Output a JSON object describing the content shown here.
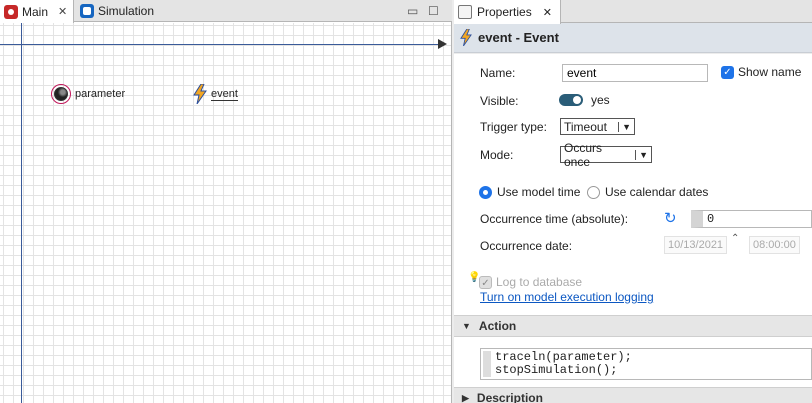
{
  "editor": {
    "tabs": [
      {
        "label": "Main",
        "icon": "main-icon",
        "active": true
      },
      {
        "label": "Simulation",
        "icon": "simulation-icon",
        "active": false
      }
    ],
    "minimize_glyph": "▭",
    "maximize_glyph": "☐",
    "canvas": {
      "elements": [
        {
          "type": "parameter",
          "label": "parameter",
          "icon": "parameter-icon"
        },
        {
          "type": "event",
          "label": "event",
          "icon": "lightning-icon"
        }
      ]
    }
  },
  "properties": {
    "tab_label": "Properties",
    "header": {
      "name": "event",
      "type": "Event",
      "title": "event - Event"
    },
    "name_label": "Name:",
    "name_value": "event",
    "show_name_label": "Show name",
    "show_name_checked": true,
    "visible_label": "Visible:",
    "visible_value": "yes",
    "trigger_label": "Trigger type:",
    "trigger_value": "Timeout",
    "mode_label": "Mode:",
    "mode_value": "Occurs once",
    "use_model_time_label": "Use model time",
    "use_calendar_label": "Use calendar dates",
    "time_mode_selected": "Use model time",
    "occurrence_time_label": "Occurrence time (absolute):",
    "occurrence_time_value": "0",
    "occurrence_date_label": "Occurrence date:",
    "occurrence_date_value": "10/13/2021",
    "occurrence_time_of_day": "08:00:00",
    "log_label": "Log to database",
    "log_link": "Turn on model execution logging",
    "action_section": "Action",
    "action_code": [
      "traceln(parameter);",
      "stopSimulation();"
    ],
    "description_section": "Description"
  },
  "colors": {
    "accent": "#1e73e8",
    "link": "#0b57c2",
    "axis": "#3a5a99"
  }
}
